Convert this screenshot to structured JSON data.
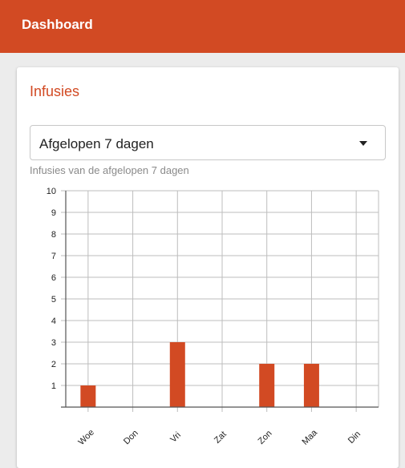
{
  "app_bar": {
    "title": "Dashboard",
    "color": "#d24a23"
  },
  "card": {
    "title": "Infusies",
    "select": {
      "value": "Afgelopen 7 dagen"
    },
    "helper_text": "Infusies van de afgelopen 7 dagen"
  },
  "chart_data": {
    "type": "bar",
    "categories": [
      "Woe",
      "Don",
      "Vri",
      "Zat",
      "Zon",
      "Maa",
      "Din"
    ],
    "values": [
      1,
      0,
      3,
      0,
      2,
      2,
      0
    ],
    "ylim": [
      0,
      10
    ],
    "yticks": [
      1,
      2,
      3,
      4,
      5,
      6,
      7,
      8,
      9,
      10
    ],
    "grid": true,
    "bar_color": "#d24a23"
  }
}
